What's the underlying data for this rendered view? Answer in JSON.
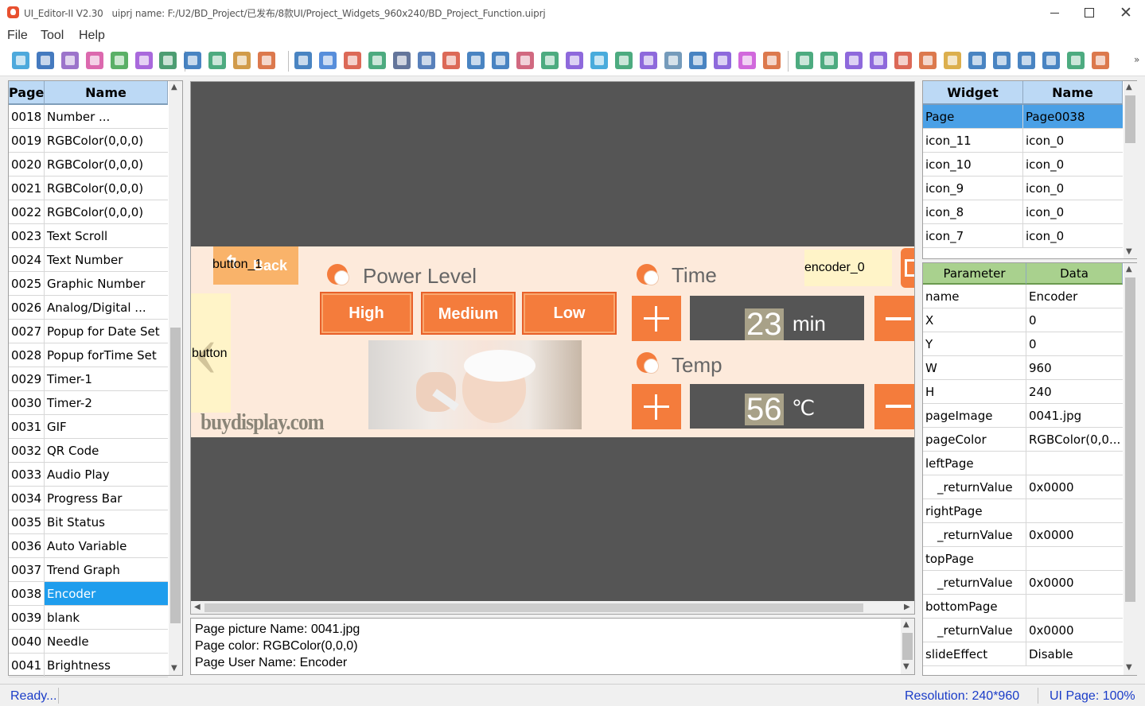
{
  "window": {
    "app_version": "UI_Editor-II V2.30",
    "project": "uiprj name: F:/U2/BD_Project/已发布/8款UI/Project_Widgets_960x240/BD_Project_Function.uiprj"
  },
  "menu": [
    "File",
    "Tool",
    "Help"
  ],
  "toolbar_icons": [
    {
      "name": "search-icon",
      "color": "#2e9bd6"
    },
    {
      "name": "page-icon",
      "color": "#2563b5"
    },
    {
      "name": "frame-icon",
      "color": "#8b5cc2"
    },
    {
      "name": "grid-icon",
      "color": "#d64fa0"
    },
    {
      "name": "qr-icon",
      "color": "#3fa34d"
    },
    {
      "name": "palette-icon",
      "color": "#9b4fd6"
    },
    {
      "name": "slider-icon",
      "color": "#2f8d5a"
    },
    {
      "name": "keyboard-icon",
      "color": "#2a6fb8"
    },
    {
      "name": "keyboard-en-icon",
      "color": "#2f9d6b"
    },
    {
      "name": "keyboard-cn-icon",
      "color": "#c98a2b"
    },
    {
      "name": "keyboard-kbk-icon",
      "color": "#d6622f"
    },
    {
      "name": "text-icon",
      "color": "#2a6fb8"
    },
    {
      "name": "text-scroll-icon",
      "color": "#3a7bd5"
    },
    {
      "name": "number-icon",
      "color": "#d64f3a"
    },
    {
      "name": "graphic-number-icon",
      "color": "#2f9d6b"
    },
    {
      "name": "clock-icon",
      "color": "#4a5d8a"
    },
    {
      "name": "digital-clock-icon",
      "color": "#3c6bb0"
    },
    {
      "name": "alarm-icon",
      "color": "#d64f3a"
    },
    {
      "name": "gif-icon",
      "color": "#2a6fb8"
    },
    {
      "name": "qrcode-icon",
      "color": "#2a6fb8"
    },
    {
      "name": "wav-icon",
      "color": "#c94f6b"
    },
    {
      "name": "progress-icon",
      "color": "#2f9d6b"
    },
    {
      "name": "gauge-icon",
      "color": "#7b4fd6"
    },
    {
      "name": "bit-icon",
      "color": "#2a9dd6"
    },
    {
      "name": "variable-icon",
      "color": "#2f9d6b"
    },
    {
      "name": "image-var-icon",
      "color": "#7b4fd6"
    },
    {
      "name": "trend-icon",
      "color": "#5d8ab0"
    },
    {
      "name": "microphone-icon",
      "color": "#2a6fb8"
    },
    {
      "name": "speedometer-icon",
      "color": "#7b4fd6"
    },
    {
      "name": "video-icon",
      "color": "#c94fd6"
    },
    {
      "name": "record-icon",
      "color": "#d6622f"
    },
    {
      "name": "align-top-icon",
      "color": "#2f9d6b"
    },
    {
      "name": "align-bottom-icon",
      "color": "#2f9d6b"
    },
    {
      "name": "align-left-icon",
      "color": "#7b4fd6"
    },
    {
      "name": "align-right-icon",
      "color": "#7b4fd6"
    },
    {
      "name": "same-width-icon",
      "color": "#d64f3a"
    },
    {
      "name": "same-height-icon",
      "color": "#d6622f"
    },
    {
      "name": "resize-icon",
      "color": "#d6a22f"
    },
    {
      "name": "distribute-h-icon",
      "color": "#2a6fb8"
    },
    {
      "name": "distribute-v-icon",
      "color": "#2a6fb8"
    },
    {
      "name": "zoom-in-icon",
      "color": "#2a6fb8"
    },
    {
      "name": "zoom-out-icon",
      "color": "#2a6fb8"
    },
    {
      "name": "fit-icon",
      "color": "#2f9d6b"
    },
    {
      "name": "chart-icon",
      "color": "#d6622f"
    }
  ],
  "pages_panel": {
    "headers": [
      "Page",
      "Name"
    ],
    "rows": [
      {
        "page": "0018",
        "name": "Number ..."
      },
      {
        "page": "0019",
        "name": "RGBColor(0,0,0)"
      },
      {
        "page": "0020",
        "name": "RGBColor(0,0,0)"
      },
      {
        "page": "0021",
        "name": "RGBColor(0,0,0)"
      },
      {
        "page": "0022",
        "name": "RGBColor(0,0,0)"
      },
      {
        "page": "0023",
        "name": "Text Scroll"
      },
      {
        "page": "0024",
        "name": "Text Number"
      },
      {
        "page": "0025",
        "name": "Graphic Number"
      },
      {
        "page": "0026",
        "name": "Analog/Digital ..."
      },
      {
        "page": "0027",
        "name": "Popup for Date Set"
      },
      {
        "page": "0028",
        "name": "Popup forTime Set"
      },
      {
        "page": "0029",
        "name": "Timer-1"
      },
      {
        "page": "0030",
        "name": "Timer-2"
      },
      {
        "page": "0031",
        "name": "GIF"
      },
      {
        "page": "0032",
        "name": "QR Code"
      },
      {
        "page": "0033",
        "name": "Audio Play"
      },
      {
        "page": "0034",
        "name": "Progress Bar"
      },
      {
        "page": "0035",
        "name": "Bit Status"
      },
      {
        "page": "0036",
        "name": "Auto Variable"
      },
      {
        "page": "0037",
        "name": "Trend Graph"
      },
      {
        "page": "0038",
        "name": "Encoder",
        "selected": true
      },
      {
        "page": "0039",
        "name": "blank"
      },
      {
        "page": "0040",
        "name": "Needle"
      },
      {
        "page": "0041",
        "name": "Brightness"
      }
    ]
  },
  "design": {
    "button_back_label": "button_1",
    "back_text": "Back",
    "button_left_label": "button",
    "encoder_label": "encoder_0",
    "power_level": "Power Level",
    "levels": [
      "High",
      "Medium",
      "Low"
    ],
    "time_label": "Time",
    "time_value": "23",
    "time_unit": "min",
    "temp_label": "Temp",
    "temp_value": "56",
    "temp_unit": "℃",
    "watermark": "buydisplay.com"
  },
  "info": {
    "lines": [
      "Page picture Name: 0041.jpg",
      "Page color: RGBColor(0,0,0)",
      "Page User Name: Encoder"
    ]
  },
  "widgets_panel": {
    "headers": [
      "Widget",
      "Name"
    ],
    "rows": [
      {
        "widget": "Page",
        "name": "Page0038",
        "selected": true
      },
      {
        "widget": "icon_11",
        "name": "icon_0"
      },
      {
        "widget": "icon_10",
        "name": "icon_0"
      },
      {
        "widget": "icon_9",
        "name": "icon_0"
      },
      {
        "widget": "icon_8",
        "name": "icon_0"
      },
      {
        "widget": "icon_7",
        "name": "icon_0"
      }
    ]
  },
  "params_panel": {
    "headers": [
      "Parameter",
      "Data"
    ],
    "rows": [
      {
        "param": "name",
        "data": "Encoder"
      },
      {
        "param": "X",
        "data": "0"
      },
      {
        "param": "Y",
        "data": "0"
      },
      {
        "param": "W",
        "data": "960"
      },
      {
        "param": "H",
        "data": "240"
      },
      {
        "param": "pageImage",
        "data": "0041.jpg"
      },
      {
        "param": "pageColor",
        "data": "RGBColor(0,0..."
      },
      {
        "param": "leftPage",
        "data": ""
      },
      {
        "param": "_returnValue",
        "data": "0x0000",
        "indent": true
      },
      {
        "param": "rightPage",
        "data": ""
      },
      {
        "param": "_returnValue",
        "data": "0x0000",
        "indent": true
      },
      {
        "param": "topPage",
        "data": ""
      },
      {
        "param": "_returnValue",
        "data": "0x0000",
        "indent": true
      },
      {
        "param": "bottomPage",
        "data": ""
      },
      {
        "param": "_returnValue",
        "data": "0x0000",
        "indent": true
      },
      {
        "param": "slideEffect",
        "data": "Disable"
      }
    ]
  },
  "status": {
    "left": "Ready...",
    "resolution": "Resolution: 240*960",
    "ui_page": "UI Page: 100%"
  },
  "colors": {
    "accent_orange": "#f47c3c",
    "selection_blue": "#1e9ded",
    "header_blue": "#bcd9f5",
    "param_header_green": "#a9d18e",
    "status_text": "#1a3cc8"
  }
}
